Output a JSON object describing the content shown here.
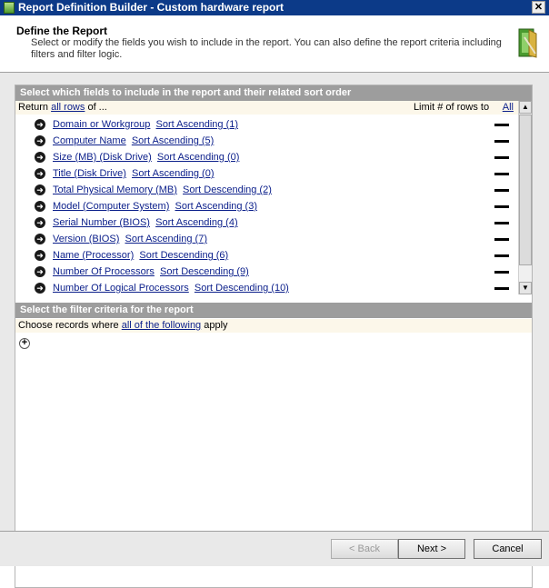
{
  "window": {
    "title": "Report Definition Builder - Custom hardware report",
    "close_glyph": "✕"
  },
  "header": {
    "title": "Define the Report",
    "description": "Select or modify the fields you wish to include in the report. You can also define the report criteria including filters and filter logic.",
    "icon": "report-wizard-icon"
  },
  "fields_section": {
    "heading": "Select which fields to include in the report and their related sort order",
    "return_prefix": "Return",
    "return_link": "all rows",
    "return_suffix": "of ...",
    "limit_label": "Limit # of rows to",
    "limit_link": "All",
    "rows": [
      {
        "field": "Domain or Workgroup",
        "sort": "Sort Ascending (1)"
      },
      {
        "field": "Computer Name",
        "sort": "Sort Ascending (5)"
      },
      {
        "field": "Size (MB) (Disk Drive)",
        "sort": "Sort Ascending (0)"
      },
      {
        "field": "Title (Disk Drive)",
        "sort": "Sort Ascending (0)"
      },
      {
        "field": "Total Physical Memory (MB)",
        "sort": "Sort Descending (2)"
      },
      {
        "field": "Model (Computer System)",
        "sort": "Sort Ascending (3)"
      },
      {
        "field": "Serial Number (BIOS)",
        "sort": "Sort Ascending (4)"
      },
      {
        "field": "Version (BIOS)",
        "sort": "Sort Ascending (7)"
      },
      {
        "field": "Name (Processor)",
        "sort": "Sort Descending (6)"
      },
      {
        "field": "Number Of Processors",
        "sort": "Sort Descending (9)"
      },
      {
        "field": "Number Of Logical Processors",
        "sort": "Sort Descending (10)"
      }
    ]
  },
  "filter_section": {
    "heading": "Select the filter criteria for the report",
    "choose_prefix": "Choose records where",
    "choose_link": "all of the following",
    "choose_suffix": "apply",
    "add_glyph": "+"
  },
  "footer": {
    "back": "< Back",
    "next": "Next >",
    "cancel": "Cancel"
  }
}
